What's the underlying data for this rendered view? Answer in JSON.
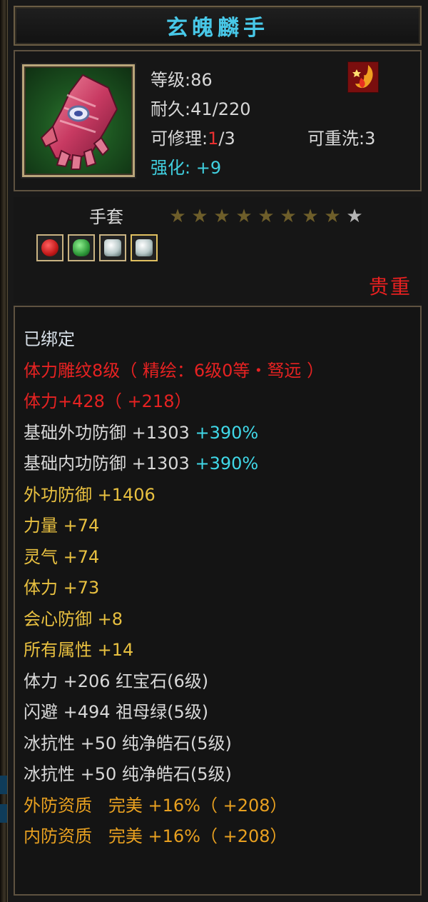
{
  "item": {
    "name": "玄魄麟手",
    "level_line": "等级:86",
    "durability_line": "耐久:41/220",
    "repair_prefix": "可修理:",
    "repair_current": "1",
    "repair_suffix": "/3",
    "reforge_line": "可重洗:3",
    "enhance_label": "强化:",
    "enhance_value": "+9",
    "type": "手套",
    "stars_filled": 8,
    "stars_total": 9,
    "quality": "贵重"
  },
  "gem_slots": [
    {
      "icon": "red-gem-icon",
      "color": "#c21818"
    },
    {
      "icon": "green-gem-icon",
      "color": "#2f9a3a"
    },
    {
      "icon": "white-gem-icon",
      "color": "#b8c8c8"
    },
    {
      "icon": "white-gem-icon",
      "color": "#b8c8c8"
    }
  ],
  "attributes": {
    "bound": "已绑定",
    "engraving": "体力雕纹8级（ 精绘：6级0等・驽远 ）",
    "stamina_total": "体力+428（ +218）",
    "base_outer_def_label": "基础外功防御 +1303",
    "base_outer_def_pct": "+390%",
    "base_inner_def_label": "基础内功防御 +1303",
    "base_inner_def_pct": "+390%",
    "outer_def": "外功防御 +1406",
    "strength": "力量 +74",
    "spirit": "灵气 +74",
    "stamina": "体力 +73",
    "crit_def": "会心防御 +8",
    "all_attr": "所有属性 +14",
    "gem1": "体力 +206 红宝石(6级)",
    "gem2": "闪避 +494 祖母绿(5级)",
    "gem3": "冰抗性 +50 纯净皓石(5级)",
    "gem4": "冰抗性 +50 纯净皓石(5级)",
    "outer_quality": "外防资质   完美 +16%（ +208）",
    "inner_quality": "内防资质   完美 +16%（ +208）"
  },
  "colors": {
    "title": "#48c8e8",
    "attribute_yellow": "#e8c040",
    "attribute_orange": "#e8a020",
    "red": "#e62222",
    "cyan": "#40d8e8"
  }
}
